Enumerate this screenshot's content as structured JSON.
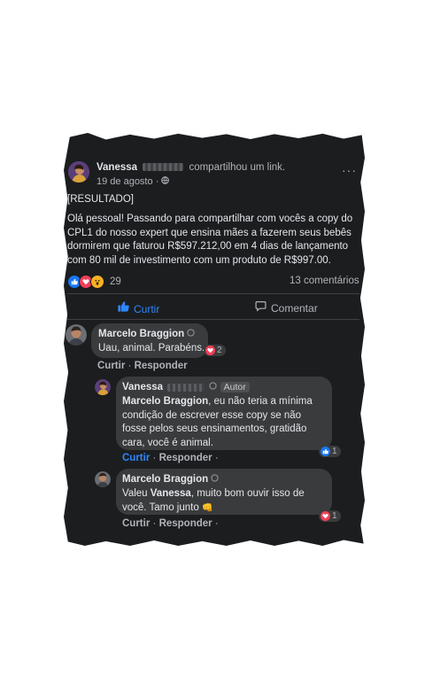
{
  "post": {
    "author": "Vanessa",
    "action": "compartilhou um link.",
    "date": "19 de agosto",
    "date_sep": "·",
    "menu": "···",
    "body_tag": "[RESULTADO]",
    "body": "Olá pessoal! Passando para compartilhar com vocês a copy do CPL1 do nosso expert que ensina mães a fazerem seus bebês dormirem que faturou R$597.212,00 em 4 dias de lançamento com 80 mil de investimento com um produto de R$997.00.",
    "reaction_count": "29",
    "comments_count": "13 comentários",
    "like_label": "Curtir",
    "comment_label": "Comentar"
  },
  "comments": [
    {
      "author": "Marcelo Braggion",
      "text": "Uau, animal. Parabéns.",
      "reaction_count": "2",
      "like": "Curtir",
      "sep": "·",
      "reply": "Responder"
    },
    {
      "author": "Vanessa",
      "badge": "Autor",
      "mention": "Marcelo Braggion",
      "text": ", eu não teria a mínima condição de escrever esse copy se não fosse pelos seus ensinamentos, gratidão cara, você é animal.",
      "reaction_count": "1",
      "like": "Curtir",
      "sep": "·",
      "reply": "Responder",
      "trail": "·"
    },
    {
      "author": "Marcelo Braggion",
      "text_pre": "Valeu ",
      "mention": "Vanessa",
      "text_post": ", muito bom ouvir isso de você. Tamo junto",
      "emoji": "👊",
      "reaction_count": "1",
      "like": "Curtir",
      "sep": "·",
      "reply": "Responder",
      "trail": "·"
    }
  ],
  "colors": {
    "background": "#1c1d1f",
    "bubble": "#3a3b3c",
    "text": "#e4e6eb",
    "muted": "#b0b3b8",
    "like_blue": "#1877f2",
    "heart_red": "#f33e58"
  }
}
